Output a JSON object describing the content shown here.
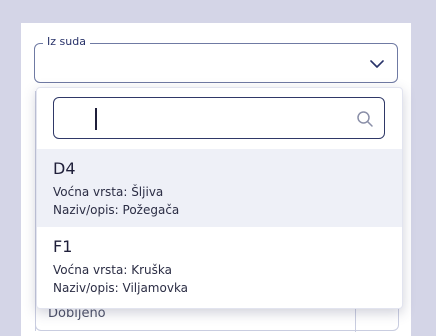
{
  "field": {
    "legend": "Iz suda",
    "value": ""
  },
  "underlying": {
    "text": "Dobijeno"
  },
  "search": {
    "value": "",
    "icon": "search-icon"
  },
  "options": [
    {
      "title": "D4",
      "line1": "Voćna vrsta: Šljiva",
      "line2": "Naziv/opis: Požegača",
      "highlighted": true
    },
    {
      "title": "F1",
      "line1": "Voćna vrsta: Kruška",
      "line2": "Naziv/opis: Viljamovka",
      "highlighted": false
    }
  ],
  "colors": {
    "background": "#d4d5e7",
    "accent": "#283269",
    "highlight": "#eef0f7"
  }
}
